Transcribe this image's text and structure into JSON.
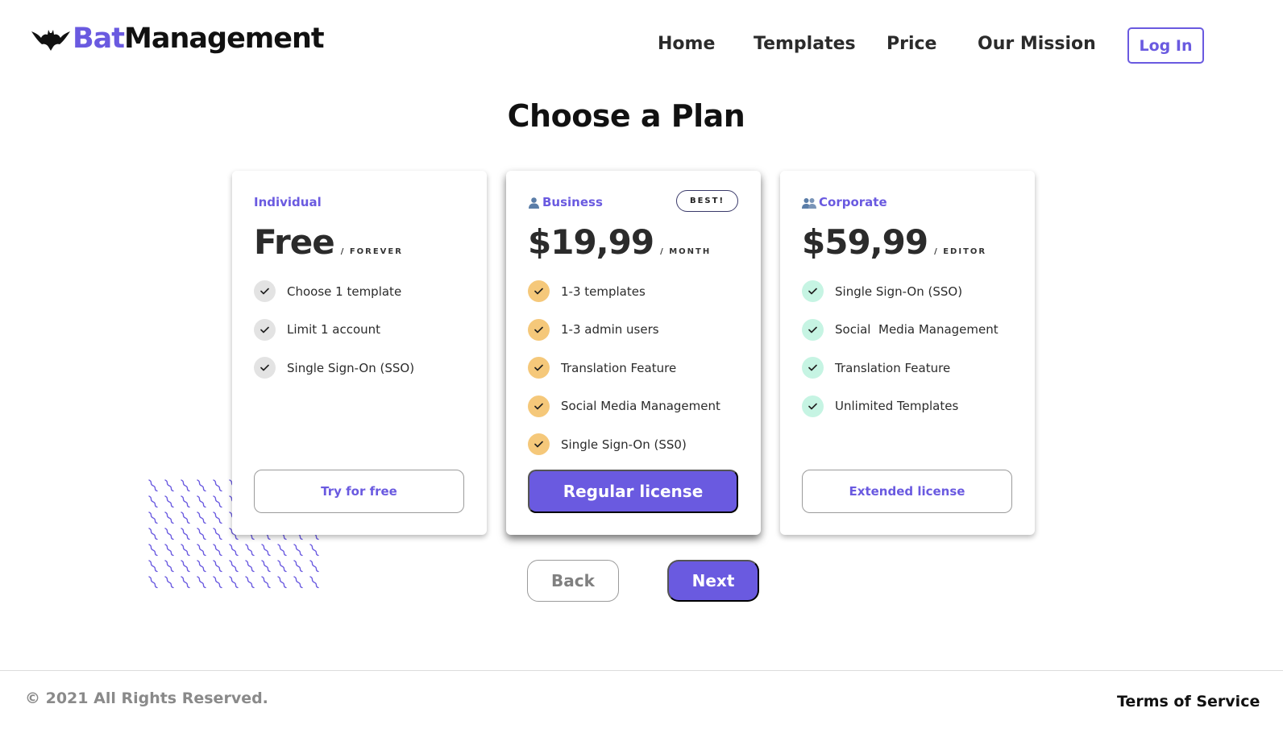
{
  "header": {
    "logo_part1": "Bat",
    "logo_part2": "Management",
    "nav": [
      "Home",
      "Templates",
      "Price",
      "Our Mission"
    ],
    "login_label": "Log In"
  },
  "page_title": "Choose a Plan",
  "plans": [
    {
      "name": "Individual",
      "price": "Free",
      "period": "/ FOREVER",
      "features": [
        "Choose 1 template",
        "Limit 1 account",
        "Single Sign-On (SSO)"
      ],
      "button_label": "Try for free",
      "check_color": "#e3e3e3"
    },
    {
      "name": "Business",
      "icon": "person-icon",
      "badge": "BEST!",
      "price": "$19,99",
      "period": "/ MONTH",
      "features": [
        "1-3 templates",
        "1-3 admin users",
        "Translation Feature",
        "Social Media Management",
        "Single Sign-On (SS0)"
      ],
      "button_label": "Regular license",
      "check_color": "#f5c87a"
    },
    {
      "name": "Corporate",
      "icon": "group-icon",
      "price": "$59,99",
      "period": "/ EDITOR",
      "features": [
        "Single Sign-On (SSO)",
        "Social  Media Management",
        "Translation Feature",
        "Unlimited Templates"
      ],
      "button_label": "Extended license",
      "check_color": "#c6f4e3"
    }
  ],
  "actions": {
    "back_label": "Back",
    "next_label": "Next"
  },
  "footer": {
    "copyright": "© 2021 All Rights Reserved.",
    "terms": "Terms of Service"
  },
  "colors": {
    "accent": "#6a5ae0",
    "text": "#2b2b2b"
  }
}
